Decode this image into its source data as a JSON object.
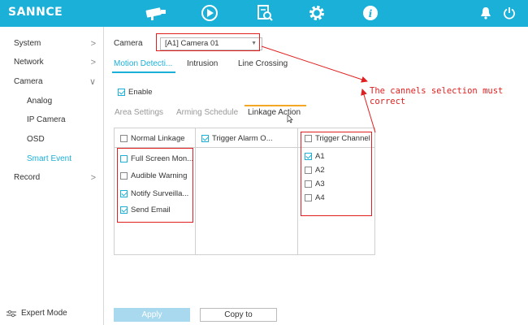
{
  "brand": {
    "logo_text": "SANNCE",
    "accent": "#1ab0d8",
    "annotation_color": "#e02020"
  },
  "topnav": {
    "icons": [
      "camera-icon",
      "playback-icon",
      "search-icon",
      "settings-icon",
      "info-icon"
    ],
    "right_icons": [
      "bell-icon",
      "power-icon"
    ]
  },
  "sidebar": {
    "items": [
      {
        "label": "System",
        "arrow": ">"
      },
      {
        "label": "Network",
        "arrow": ">"
      },
      {
        "label": "Camera",
        "arrow": "∨"
      },
      {
        "label": "Analog"
      },
      {
        "label": "IP Camera"
      },
      {
        "label": "OSD"
      },
      {
        "label": "Smart Event"
      },
      {
        "label": "Record",
        "arrow": ">"
      }
    ],
    "expert_mode": "Expert Mode"
  },
  "main": {
    "camera_label": "Camera",
    "camera_value": "[A1] Camera 01",
    "tabs": [
      "Motion Detecti...",
      "Intrusion",
      "Line Crossing"
    ],
    "enable_label": "Enable",
    "subtabs": [
      "Area Settings",
      "Arming Schedule",
      "Linkage Action"
    ],
    "col1": {
      "header": "Normal Linkage",
      "items": [
        {
          "label": "Full Screen Mon...",
          "checked": false
        },
        {
          "label": "Audible Warning",
          "checked": false
        },
        {
          "label": "Notify Surveilla...",
          "checked": true
        },
        {
          "label": "Send Email",
          "checked": true
        }
      ]
    },
    "col2": {
      "header": "Trigger Alarm O..."
    },
    "col3": {
      "header": "Trigger Channel",
      "items": [
        {
          "label": "A1",
          "checked": true
        },
        {
          "label": "A2",
          "checked": false
        },
        {
          "label": "A3",
          "checked": false
        },
        {
          "label": "A4",
          "checked": false
        }
      ]
    },
    "apply_label": "Apply",
    "copy_label": "Copy to"
  },
  "annotation": {
    "line1": "The cannels selection must",
    "line2": "correct"
  }
}
